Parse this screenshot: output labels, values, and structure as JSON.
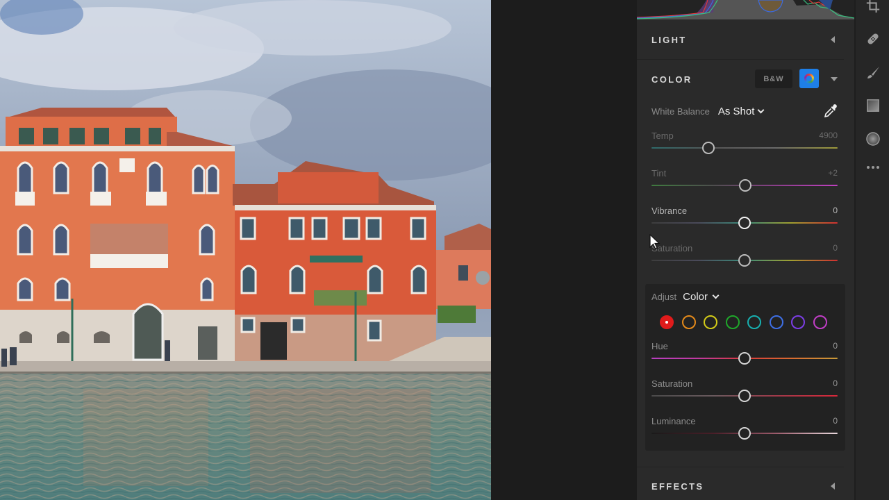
{
  "photo": {
    "subject": "Venetian canal with orange-red palazzos"
  },
  "panel": {
    "sections": {
      "light": {
        "title": "LIGHT",
        "state": "collapsed"
      },
      "color": {
        "title": "COLOR",
        "state": "expanded",
        "bw_label": "B&W",
        "color_mode_active": true,
        "white_balance": {
          "label": "White Balance",
          "value": "As Shot"
        },
        "sliders": [
          {
            "name": "temp",
            "label": "Temp",
            "value": "4900",
            "position": 0.305,
            "style": "dim",
            "gradient": [
              "#2f6b6b",
              "#565656",
              "#6a6a6a",
              "#9e9a3a"
            ]
          },
          {
            "name": "tint",
            "label": "Tint",
            "value": "+2",
            "position": 0.505,
            "style": "dim",
            "gradient": [
              "#3f7a3f",
              "#4e4e4e",
              "#8a3f8a",
              "#c040c0"
            ]
          },
          {
            "name": "vibrance",
            "label": "Vibrance",
            "value": "0",
            "position": 0.5,
            "style": "bright",
            "gradient": [
              "#3d3d3d",
              "#4a4a5a",
              "#3c8a7a",
              "#a0a030",
              "#d03030"
            ]
          },
          {
            "name": "saturation",
            "label": "Saturation",
            "value": "0",
            "position": 0.5,
            "style": "dim",
            "gradient": [
              "#3d3d3d",
              "#4a4a5a",
              "#3c8a7a",
              "#a0a030",
              "#d03030"
            ]
          }
        ],
        "mixer": {
          "adjust_label": "Adjust",
          "adjust_value": "Color",
          "swatches": [
            {
              "name": "red",
              "color": "#e01b1b",
              "active": true
            },
            {
              "name": "orange",
              "color": "#e58a1a",
              "active": false
            },
            {
              "name": "yellow",
              "color": "#d4cc18",
              "active": false
            },
            {
              "name": "green",
              "color": "#1fa82a",
              "active": false
            },
            {
              "name": "aqua",
              "color": "#17b0b0",
              "active": false
            },
            {
              "name": "blue",
              "color": "#3e6fe6",
              "active": false
            },
            {
              "name": "purple",
              "color": "#7c3ee6",
              "active": false
            },
            {
              "name": "magenta",
              "color": "#c23ec8",
              "active": false
            }
          ],
          "sliders": [
            {
              "name": "hue",
              "label": "Hue",
              "value": "0",
              "position": 0.5,
              "gradient": [
                "#b83fc0",
                "#c03aa0",
                "#d83a3a",
                "#d86a30",
                "#c89a38"
              ]
            },
            {
              "name": "saturation",
              "label": "Saturation",
              "value": "0",
              "position": 0.5,
              "gradient": [
                "#4a4a4a",
                "#6a5a5e",
                "#a03a4a",
                "#d8283a"
              ]
            },
            {
              "name": "luminance",
              "label": "Luminance",
              "value": "0",
              "position": 0.5,
              "gradient": [
                "#1a1a1a",
                "#4a1e28",
                "#9a5a6a",
                "#e8d8dc"
              ]
            }
          ]
        }
      },
      "effects": {
        "title": "EFFECTS",
        "state": "collapsed"
      }
    }
  },
  "rail": {
    "tools": [
      "crop-icon",
      "healing-icon",
      "brush-icon",
      "linear-gradient-icon",
      "radial-gradient-icon",
      "more-icon"
    ]
  }
}
